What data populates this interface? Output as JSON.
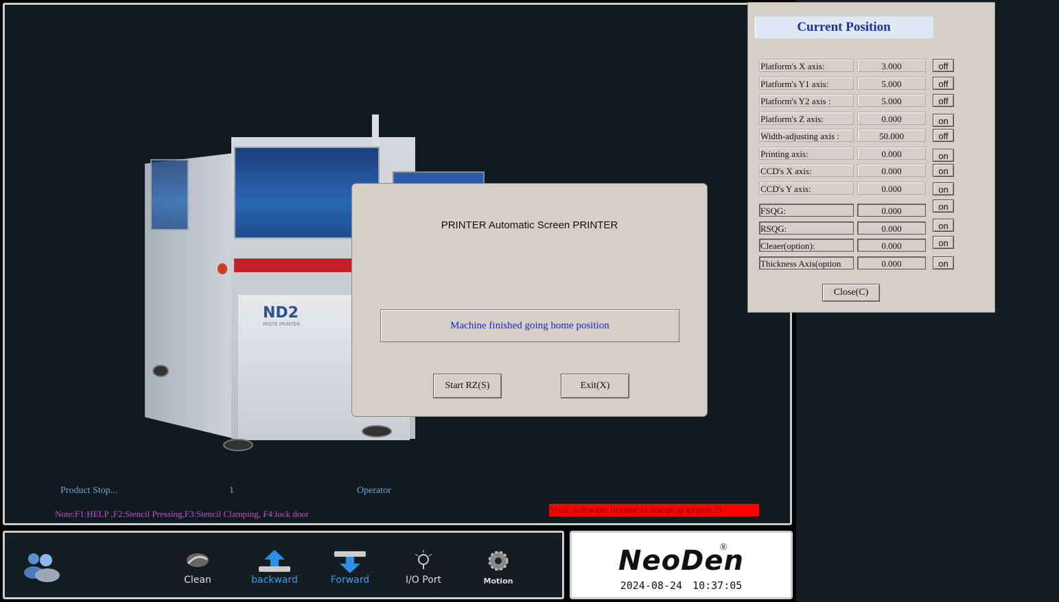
{
  "machine": {
    "model_label": "ND2",
    "model_sublabel": "PASTE PRINTER"
  },
  "status": {
    "product_state": "Product Stop...",
    "count": "1",
    "user_role": "Operator",
    "note": "Note:F1:HELP ,F2:Stencil Pressing,F3:Stencil  Clamping, F4:lock door",
    "license_warning": "Your software license is about to expire.D"
  },
  "dialog": {
    "title": "PRINTER Automatic Screen PRINTER",
    "message": "Machine finished going home position",
    "start_label": "Start RZ(S)",
    "exit_label": "Exit(X)"
  },
  "position_panel": {
    "title": "Current Position",
    "rows": [
      {
        "label": "Platform's X axis:",
        "value": "3.000",
        "state": "off"
      },
      {
        "label": "Platform's Y1 axis:",
        "value": "5.000",
        "state": "off"
      },
      {
        "label": "Platform's Y2 axis :",
        "value": "5.000",
        "state": "off"
      },
      {
        "label": "Platform's Z axis:",
        "value": "0.000",
        "state": "on"
      },
      {
        "label": "Width-adjusting axis :",
        "value": "50.000",
        "state": "off"
      },
      {
        "label": "Printing axis:",
        "value": "0.000",
        "state": "on"
      },
      {
        "label": "CCD's X axis:",
        "value": "0.000",
        "state": "on"
      },
      {
        "label": "CCD's Y axis:",
        "value": "0.000",
        "state": "on"
      },
      {
        "label": "FSQG:",
        "value": "0.000",
        "state": "on"
      },
      {
        "label": "RSQG:",
        "value": "0.000",
        "state": "on"
      },
      {
        "label": "Cleaer(option):",
        "value": "0.000",
        "state": "on"
      },
      {
        "label": "Thickness Axis(option",
        "value": "0.000",
        "state": "on"
      }
    ],
    "close_label": "Close(C)"
  },
  "toolbar": {
    "user_icon": "users-icon",
    "clean_label": "Clean",
    "backward_label": "backward",
    "forward_label": "Forward",
    "io_label": "I/O Port",
    "motion_label": "Motion"
  },
  "brand": {
    "logo": "NeoDen",
    "registered": "®",
    "datetime": "2024-08-24 10:37:05"
  },
  "colors": {
    "background": "#111a1e",
    "dialog": "#d4d0c8",
    "status_blue": "#1e27b8",
    "title_blue": "#1a2fa8",
    "note_magenta": "#c24fd3",
    "warning_red": "#ff0000",
    "toolbar_blue": "#3a9dec"
  }
}
